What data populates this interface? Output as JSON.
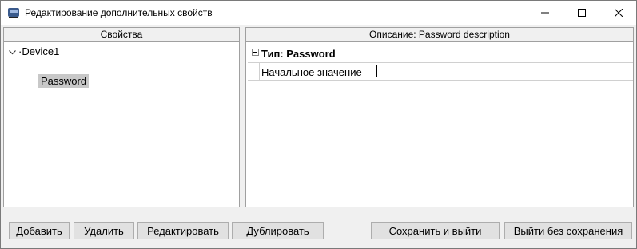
{
  "window": {
    "title": "Редактирование дополнительных свойств"
  },
  "left_panel": {
    "header": "Свойства",
    "tree": {
      "root": "Device1",
      "children": [
        "Password"
      ]
    }
  },
  "right_panel": {
    "header": "Описание: Password description",
    "category": "Тип: Password",
    "rows": [
      {
        "name": "Начальное значение",
        "value": ""
      }
    ]
  },
  "buttons": {
    "add": "Добавить",
    "delete": "Удалить",
    "edit": "Редактировать",
    "duplicate": "Дублировать",
    "save_exit": "Сохранить и выйти",
    "exit_no_save": "Выйти без сохранения"
  },
  "colors": {
    "selection": "#c8c8c8",
    "border": "#a0a0a0",
    "button_bg": "#e1e1e1"
  }
}
